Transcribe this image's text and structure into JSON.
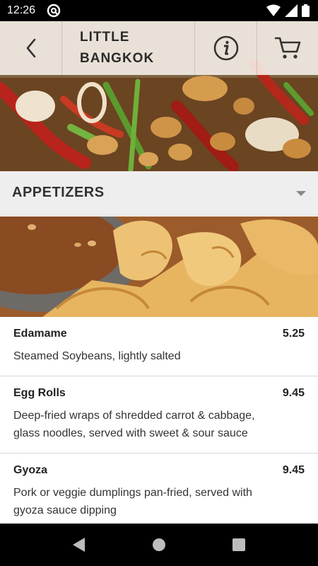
{
  "status_bar": {
    "time": "12:26",
    "app_icon": "at-sign-icon",
    "icons": [
      "wifi-icon",
      "signal-icon",
      "battery-icon"
    ]
  },
  "header": {
    "back_icon": "chevron-left-icon",
    "title": "LITTLE\nBANGKOK",
    "info_icon": "info-icon",
    "cart_icon": "cart-icon"
  },
  "category": {
    "title": "APPETIZERS",
    "caret_icon": "caret-down-icon"
  },
  "menu_items": [
    {
      "name": "Edamame",
      "price": "5.25",
      "description": "Steamed Soybeans, lightly salted"
    },
    {
      "name": "Egg Rolls",
      "price": "9.45",
      "description": "Deep-fried wraps of shredded carrot & cabbage, glass noodles, served with sweet & sour sauce"
    },
    {
      "name": "Gyoza",
      "price": "9.45",
      "description": "Pork or veggie dumplings pan-fried, served with gyoza sauce dipping"
    }
  ],
  "nav_bar": {
    "back": "back-triangle-icon",
    "home": "home-circle-icon",
    "recents": "recents-square-icon"
  },
  "colors": {
    "header_overlay": "#faf6f0",
    "category_bg": "#eeeeee",
    "text": "#222222",
    "divider": "#d6d6d6"
  }
}
